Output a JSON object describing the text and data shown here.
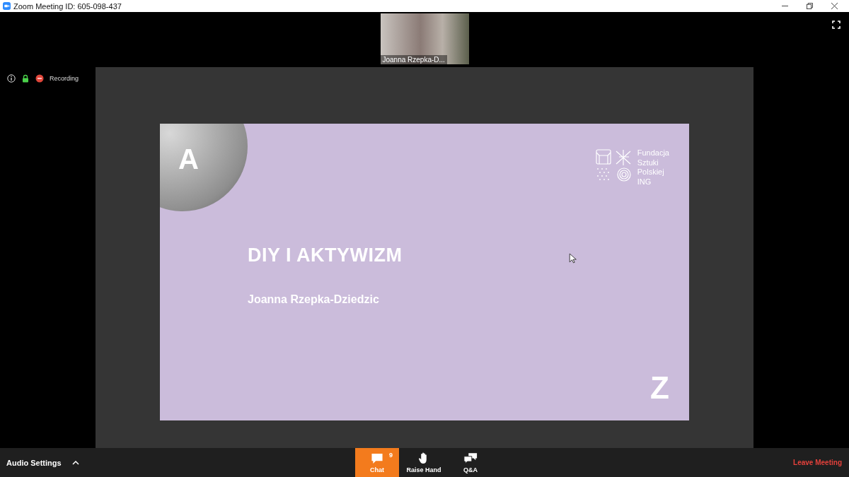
{
  "window": {
    "title": "Zoom Meeting ID: 605-098-437"
  },
  "participant_video": {
    "name": "Joanna Rzepka-D..."
  },
  "status": {
    "recording_label": "Recording"
  },
  "slide": {
    "letter_top": "A",
    "title": "DIY I AKTYWIZM",
    "author": "Joanna Rzepka-Dziedzic",
    "logo_lines": [
      "Fundacja",
      "Sztuki",
      "Polskiej",
      "ING"
    ],
    "letter_bottom": "Z"
  },
  "toolbar": {
    "audio_settings": "Audio Settings",
    "leave": "Leave Meeting",
    "buttons": [
      {
        "kind": "chat",
        "label": "Chat",
        "badge": "9",
        "selected": true
      },
      {
        "kind": "raise-hand",
        "label": "Raise Hand",
        "selected": false
      },
      {
        "kind": "qa",
        "label": "Q&A",
        "selected": false
      }
    ]
  }
}
